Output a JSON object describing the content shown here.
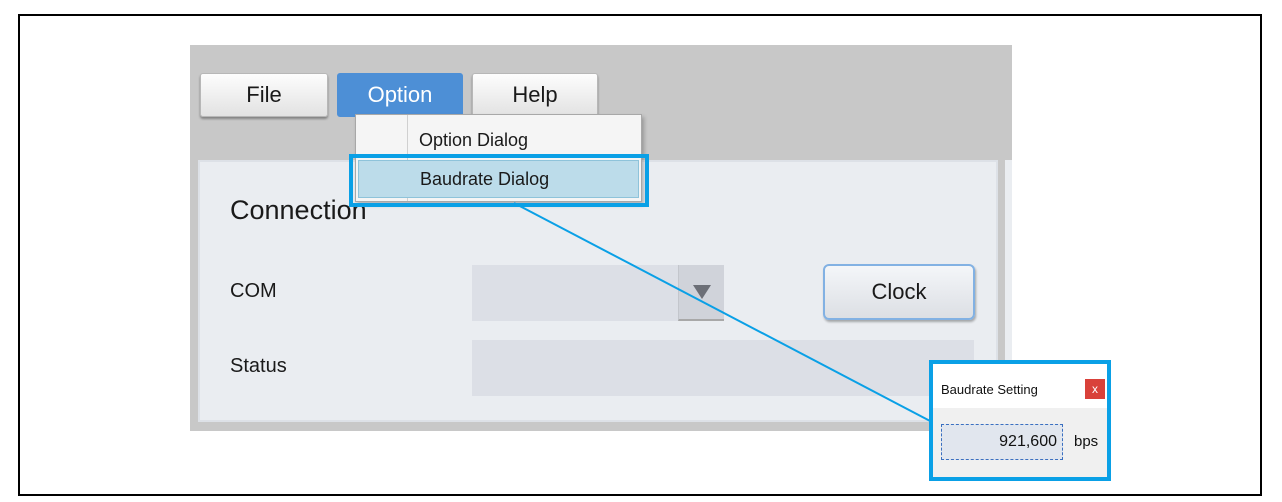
{
  "menu": {
    "file_label": "File",
    "option_label": "Option",
    "help_label": "Help"
  },
  "dropdown": {
    "items": [
      {
        "label": "Option Dialog"
      },
      {
        "label": "Baudrate Dialog"
      }
    ]
  },
  "panel": {
    "title": "Connection",
    "com_label": "COM",
    "status_label": "Status",
    "com_value": "",
    "status_value": "",
    "clock_label": "Clock"
  },
  "baud_dialog": {
    "title": "Baudrate Setting",
    "close_label": "x",
    "value": "921,600",
    "unit": "bps"
  },
  "icons": {
    "combo_arrow": "triangle-down-icon"
  },
  "colors": {
    "accent": "#4d8fd6",
    "highlight": "#0aa0e6",
    "close": "#d9413a"
  }
}
